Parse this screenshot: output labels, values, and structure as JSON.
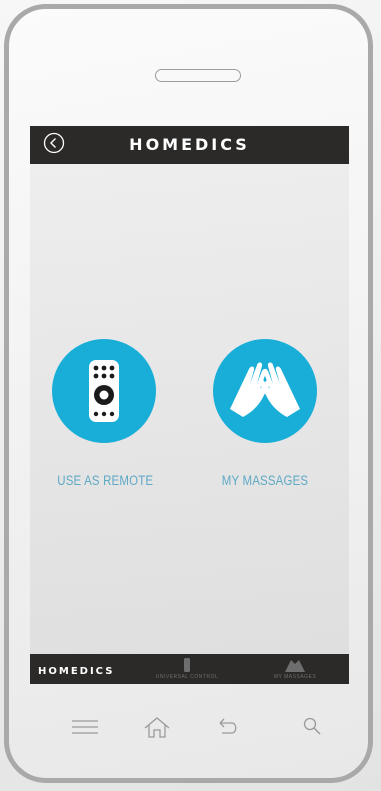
{
  "header": {
    "brand": "HOMEDICS",
    "back_icon": "back-circle-icon"
  },
  "main": {
    "tiles": [
      {
        "label": "USE AS REMOTE",
        "icon": "remote-control-icon",
        "color": "#18aed8"
      },
      {
        "label": "MY MASSAGES",
        "icon": "massage-hands-icon",
        "color": "#18aed8"
      }
    ]
  },
  "bottom_bar": {
    "brand": "HOMEDICS",
    "tabs": [
      {
        "label": "UNIVERSAL CONTROL",
        "icon": "remote-icon"
      },
      {
        "label": "MY MASSAGES",
        "icon": "hands-icon"
      }
    ]
  },
  "device_nav": {
    "buttons": [
      "menu-icon",
      "home-icon",
      "back-arrow-icon",
      "search-icon"
    ]
  },
  "colors": {
    "accent": "#18aed8",
    "bar": "#2b2a29",
    "label": "#5ea9c5"
  }
}
